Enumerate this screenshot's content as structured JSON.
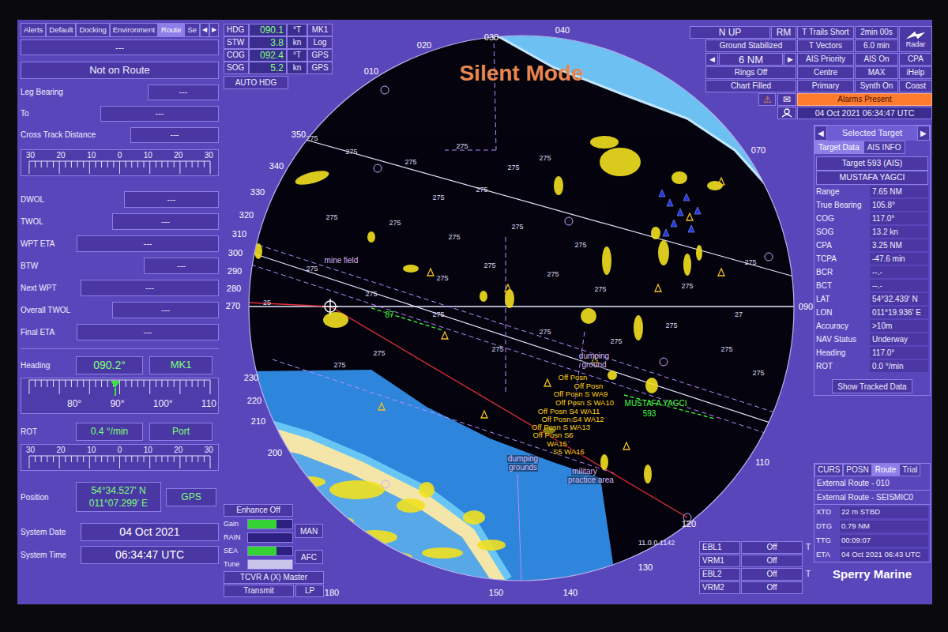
{
  "left": {
    "tabs": [
      {
        "label": "Alerts",
        "selected": false
      },
      {
        "label": "Default",
        "selected": false
      },
      {
        "label": "Docking",
        "selected": false
      },
      {
        "label": "Environment",
        "selected": false
      },
      {
        "label": "Route",
        "selected": true
      },
      {
        "label": "Se",
        "selected": false
      }
    ],
    "tab_arrows": [
      "◀",
      "▶"
    ],
    "top_field": "---",
    "route_status": "Not on Route",
    "fields_a": [
      {
        "label": "Leg Bearing",
        "value": "---"
      },
      {
        "label": "To",
        "value": "---"
      },
      {
        "label": "Cross Track Distance",
        "value": "---"
      }
    ],
    "xtd_scale": [
      "30",
      "20",
      "10",
      "0",
      "10",
      "20",
      "30"
    ],
    "fields_b": [
      {
        "label": "DWOL",
        "value": "---"
      },
      {
        "label": "TWOL",
        "value": "---"
      },
      {
        "label": "WPT ETA",
        "value": "---"
      },
      {
        "label": "BTW",
        "value": "---"
      },
      {
        "label": "Next WPT",
        "value": "---"
      },
      {
        "label": "Overall TWOL",
        "value": "---"
      },
      {
        "label": "Final ETA",
        "value": "---"
      }
    ],
    "heading": {
      "label": "Heading",
      "value": "090.2°",
      "source": "MK1"
    },
    "compass": [
      "80°",
      "90°",
      "100°",
      "110"
    ],
    "rot": {
      "label": "ROT",
      "value": "0.4 °/min",
      "direction": "Port"
    },
    "rot_scale": [
      "30",
      "20",
      "10",
      "0",
      "10",
      "20",
      "30"
    ],
    "position": {
      "label": "Position",
      "lat": "54°34.527' N",
      "lon": "011°07.299' E",
      "source": "GPS"
    },
    "system_date": {
      "label": "System Date",
      "value": "04 Oct 2021"
    },
    "system_time": {
      "label": "System Time",
      "value": "06:34:47 UTC"
    }
  },
  "nav": [
    {
      "label": "HDG",
      "value": "090.1",
      "unit": "°T",
      "source": "MK1"
    },
    {
      "label": "STW",
      "value": "3.8",
      "unit": "kn",
      "source": "Log"
    },
    {
      "label": "COG",
      "value": "092.4",
      "unit": "°T",
      "source": "GPS"
    },
    {
      "label": "SOG",
      "value": "5.2",
      "unit": "kn",
      "source": "GPS"
    }
  ],
  "auto_hdg": "AUTO HDG",
  "controls": {
    "orientation": "N UP",
    "motion": "RM",
    "trails": "T Trails Short",
    "trails_time": "2min 00s",
    "radar": "Radar",
    "stabilization": "Ground Stabilized",
    "vectors": "T Vectors",
    "vectors_time": "6.0 min",
    "range_prev": "◀",
    "range": "6 NM",
    "range_next": "▶",
    "rings": "Rings Off",
    "chart": "Chart Filled",
    "grid": [
      [
        "AIS Priority",
        "AIS On",
        "CPA"
      ],
      [
        "Centre",
        "MAX",
        "iHelp"
      ],
      [
        "Primary",
        "Synth On",
        "Coast"
      ]
    ],
    "alarm_icon": "⚠",
    "mail_icon": "✉",
    "alarms": "Alarms Present",
    "datetime": "04 Oct 2021 06:34:47 UTC"
  },
  "chart": {
    "silent": "Silent Mode",
    "bearings": [
      "010",
      "020",
      "030",
      "040",
      "070",
      "090",
      "110",
      "120",
      "130",
      "140",
      "150",
      "180",
      "200",
      "210",
      "220",
      "230",
      "270",
      "280",
      "290",
      "300",
      "310",
      "320",
      "330",
      "340",
      "350"
    ],
    "soundings": [
      "275",
      "275",
      "275",
      "275",
      "275",
      "275",
      "275",
      "275",
      "275",
      "275",
      "275",
      "275",
      "275",
      "275",
      "275",
      "275",
      "275",
      "275",
      "275",
      "275",
      "275",
      "275",
      "275",
      "275",
      "275",
      "275",
      "275",
      "275",
      "275",
      "275",
      "25",
      "27"
    ],
    "labels": [
      {
        "text": "mine field",
        "kind": "area"
      },
      {
        "text": "dumping",
        "kind": "area"
      },
      {
        "text": "ground",
        "kind": "area"
      },
      {
        "text": "military",
        "kind": "area"
      },
      {
        "text": "practice area",
        "kind": "area"
      },
      {
        "text": "dumping",
        "kind": "area"
      },
      {
        "text": "grounds",
        "kind": "area"
      },
      {
        "text": "87",
        "kind": "ais"
      },
      {
        "text": "MUSTAFA YAGCI",
        "kind": "ais"
      },
      {
        "text": "593",
        "kind": "ais"
      },
      {
        "text": "Off Posn",
        "kind": "alert"
      },
      {
        "text": "Off Posn",
        "kind": "alert"
      },
      {
        "text": "Off Posn S WA9",
        "kind": "alert"
      },
      {
        "text": "Off Posn S WA10",
        "kind": "alert"
      },
      {
        "text": "Off Posn S4 WA11",
        "kind": "alert"
      },
      {
        "text": "Off Posn S4 WA12",
        "kind": "alert"
      },
      {
        "text": "Off Posn S WA13",
        "kind": "alert"
      },
      {
        "text": "Off Posn S6",
        "kind": "alert"
      },
      {
        "text": "WA15",
        "kind": "alert"
      },
      {
        "text": "S5 WA16",
        "kind": "alert"
      }
    ]
  },
  "target": {
    "title": "Selected Target",
    "prev": "◀",
    "next": "▶",
    "tabs": [
      {
        "label": "Target Data",
        "selected": true
      },
      {
        "label": "AIS INFO",
        "selected": false
      }
    ],
    "id": "Target 593 (AIS)",
    "name": "MUSTAFA YAGCI",
    "rows": [
      {
        "label": "Range",
        "value": "7.65 NM"
      },
      {
        "label": "True Bearing",
        "value": "105.8°"
      },
      {
        "label": "COG",
        "value": "117.0°"
      },
      {
        "label": "SOG",
        "value": "13.2 kn"
      },
      {
        "label": "CPA",
        "value": "3.25 NM"
      },
      {
        "label": "TCPA",
        "value": "-47.6 min"
      },
      {
        "label": "BCR",
        "value": "--.-"
      },
      {
        "label": "BCT",
        "value": "--.-"
      },
      {
        "label": "LAT",
        "value": "54°32.439' N"
      },
      {
        "label": "LON",
        "value": "011°19.936' E"
      },
      {
        "label": "Accuracy",
        "value": ">10m"
      },
      {
        "label": "NAV Status",
        "value": "Underway"
      },
      {
        "label": "Heading",
        "value": "117.0°"
      },
      {
        "label": "ROT",
        "value": "0.0 °/min"
      }
    ],
    "button": "Show Tracked Data"
  },
  "route": {
    "tabs": [
      {
        "label": "CURS",
        "selected": false
      },
      {
        "label": "POSN",
        "selected": false
      },
      {
        "label": "Route",
        "selected": true
      },
      {
        "label": "Trial",
        "selected": false
      }
    ],
    "lines": [
      "External Route - 010",
      "External Route - SEISMIC0"
    ],
    "rows": [
      {
        "label": "XTD",
        "value": "22 m STBD"
      },
      {
        "label": "DTG",
        "value": "0.79 NM"
      },
      {
        "label": "TTG",
        "value": "00:09:07"
      },
      {
        "label": "ETA",
        "value": "04 Oct 2021 06:43 UTC"
      }
    ]
  },
  "logo": "Sperry Marine",
  "video": {
    "enhance": "Enhance Off",
    "controls": [
      {
        "label": "Gain",
        "level": 0.65,
        "color": "#35d235"
      },
      {
        "label": "RAIN",
        "level": 0,
        "color": "#35d235"
      },
      {
        "label": "SEA",
        "level": 0.65,
        "color": "#35d235"
      },
      {
        "label": "Tune",
        "level": 1,
        "color": "#c9c4ea"
      }
    ],
    "man": "MAN",
    "afc": "AFC",
    "tcvr": "TCVR A (X) Master",
    "transmit": "Transmit",
    "lp": "LP"
  },
  "ebl_vrm": [
    {
      "label": "EBL1",
      "value": "Off",
      "suffix": "T"
    },
    {
      "label": "VRM1",
      "value": "Off",
      "suffix": ""
    },
    {
      "label": "EBL2",
      "value": "Off",
      "suffix": "T"
    },
    {
      "label": "VRM2",
      "value": "Off",
      "suffix": ""
    }
  ],
  "version": "11.0.0.1142"
}
